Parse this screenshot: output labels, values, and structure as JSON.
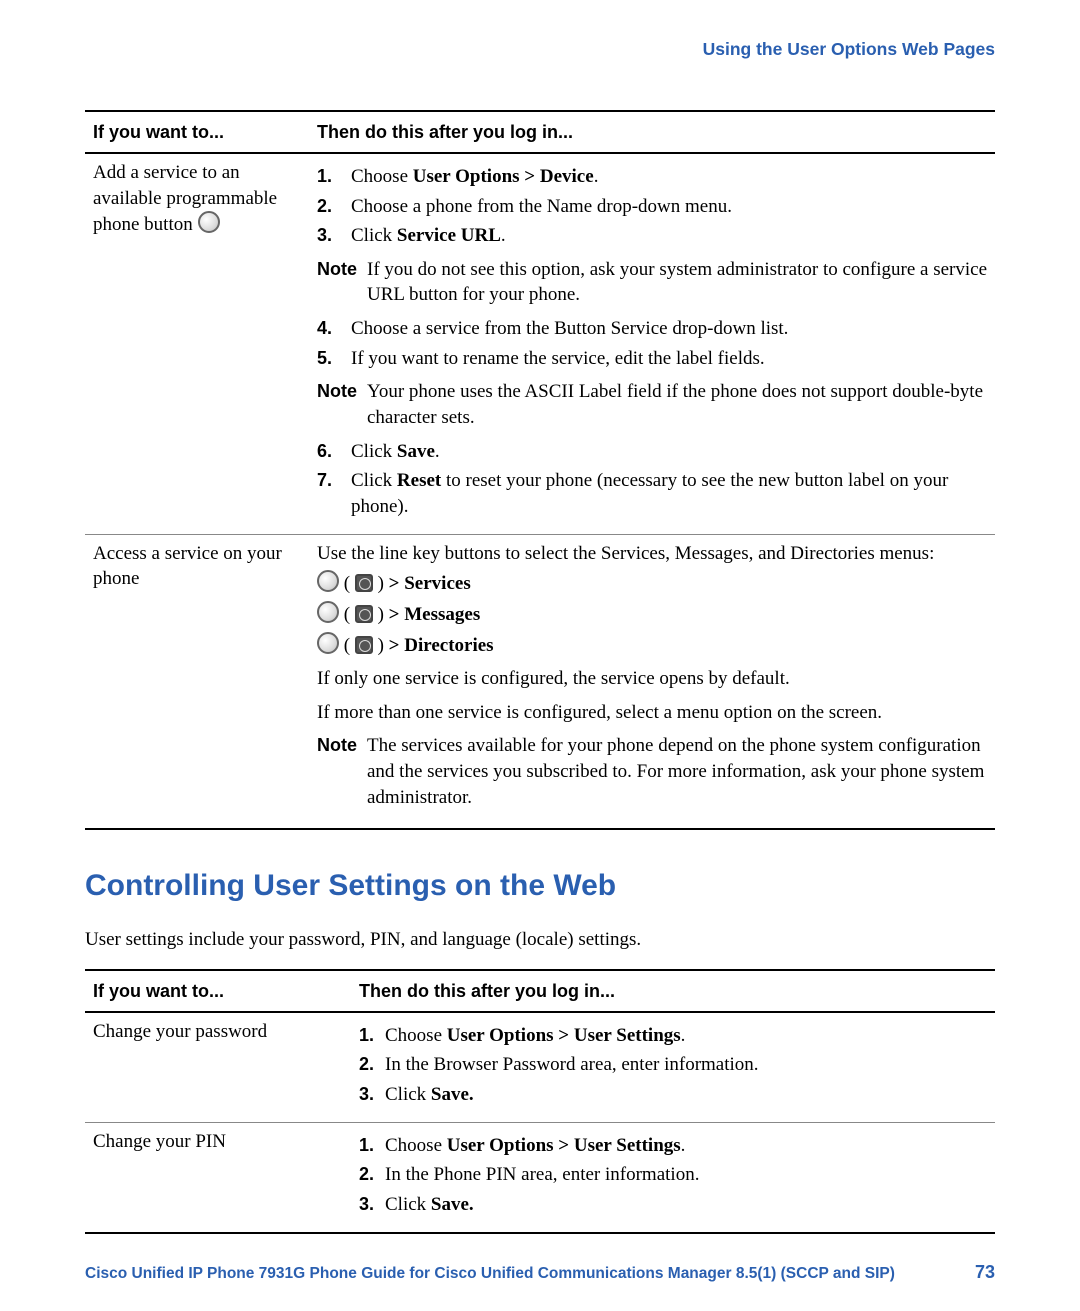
{
  "runningHead": "Using the User Options Web Pages",
  "labels": {
    "note": "Note"
  },
  "table1": {
    "head": {
      "col1": "If you want to...",
      "col2": "Then do this after you log in..."
    },
    "row1": {
      "left_prefix": "Add a service to an available programmable phone button ",
      "step1_pre": "Choose ",
      "step1_bold": "User Options > Device",
      "step1_post": ".",
      "step2": "Choose a phone from the Name drop-down menu.",
      "step3_pre": "Click ",
      "step3_bold": "Service URL",
      "step3_post": ".",
      "note1": "If you do not see this option, ask your system administrator to configure a service URL button for your phone.",
      "step4": "Choose a service from the Button Service drop-down list.",
      "step5": "If you want to rename the service, edit the label fields.",
      "note2": "Your phone uses the ASCII Label field if the phone does not support double-byte character sets.",
      "step6_pre": "Click ",
      "step6_bold": "Save",
      "step6_post": ".",
      "step7_pre": "Click ",
      "step7_bold": "Reset",
      "step7_post": " to reset your phone (necessary to see the new button label on your phone)."
    },
    "row2": {
      "left": "Access a service on your phone",
      "intro": "Use the line key buttons to select the Services, Messages, and Directories menus:",
      "line_services": "Services",
      "line_messages": "Messages",
      "line_directories": "Directories",
      "one": "If only one service is configured, the service opens by default.",
      "many": "If more than one service is configured, select a menu option on the screen.",
      "note": "The services available for your phone depend on the phone system configuration and the services you subscribed to. For more information, ask your phone system administrator."
    }
  },
  "sectionHeading": "Controlling User Settings on the Web",
  "intro": "User settings include your password, PIN, and language (locale) settings.",
  "table2": {
    "head": {
      "col1": "If you want to...",
      "col2": "Then do this after you log in..."
    },
    "row1": {
      "left": "Change your password",
      "step1_pre": "Choose ",
      "step1_bold": "User Options > User Settings",
      "step1_post": ".",
      "step2": "In the Browser Password area, enter information.",
      "step3_pre": "Click ",
      "step3_bold": "Save.",
      "step3_post": ""
    },
    "row2": {
      "left": "Change your PIN",
      "step1_pre": "Choose ",
      "step1_bold": "User Options > User Settings",
      "step1_post": ".",
      "step2": "In the Phone PIN area, enter information.",
      "step3_pre": "Click ",
      "step3_bold": "Save.",
      "step3_post": ""
    }
  },
  "footer": {
    "title": "Cisco Unified IP Phone 7931G Phone Guide for Cisco Unified Communications Manager 8.5(1) (SCCP and SIP)",
    "page": "73"
  },
  "nums": {
    "n1": "1.",
    "n2": "2.",
    "n3": "3.",
    "n4": "4.",
    "n5": "5.",
    "n6": "6.",
    "n7": "7."
  }
}
